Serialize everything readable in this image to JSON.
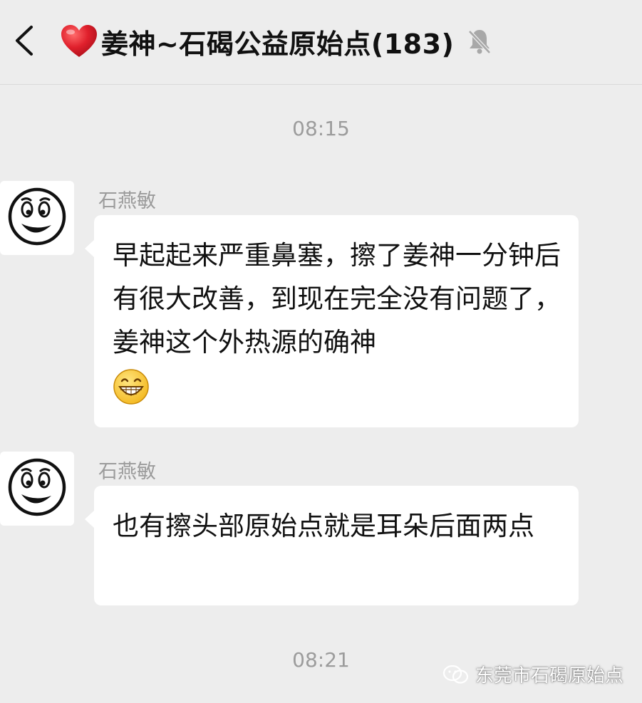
{
  "header": {
    "title": "姜神~石碣公益原始点(183)",
    "back_icon": "chevron-left-icon",
    "heart_icon": "red-heart-emoji",
    "mute_icon": "bell-off-icon"
  },
  "timestamps": [
    "08:15",
    "08:21"
  ],
  "messages": [
    {
      "sender": "石燕敏",
      "avatar_icon": "smiley-face-avatar",
      "text": "早起起来严重鼻塞，擦了姜神一分钟后有很大改善，到现在完全没有问题了，姜神这个外热源的确神",
      "emoji": "grinning-face-emoji"
    },
    {
      "sender": "石燕敏",
      "avatar_icon": "smiley-face-avatar",
      "text": "也有擦头部原始点就是耳朵后面两点"
    }
  ],
  "watermark": {
    "icon": "wechat-official-account-icon",
    "text": "东莞市石碣原始点"
  },
  "colors": {
    "background": "#ededed",
    "bubble": "#ffffff",
    "heart": "#e0202c",
    "muted_text": "#9c9c9c"
  }
}
